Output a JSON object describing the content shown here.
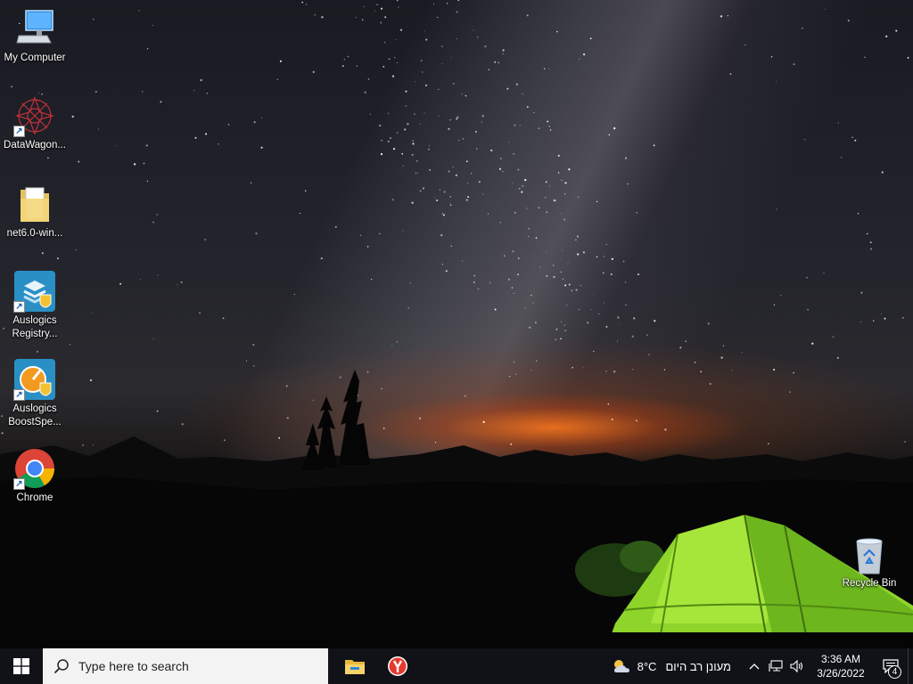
{
  "desktop": {
    "icons": [
      {
        "label": "My Computer",
        "icon": "computer-icon",
        "shortcut": false
      },
      {
        "label": "DataWagon...",
        "icon": "datawagon-icon",
        "shortcut": true
      },
      {
        "label": "net6.0-win...",
        "icon": "folder-icon",
        "shortcut": false
      },
      {
        "label": "Auslogics Registry...",
        "icon": "auslogics-registry-icon",
        "shortcut": true
      },
      {
        "label": "Auslogics BoostSpe...",
        "icon": "auslogics-boostspeed-icon",
        "shortcut": true
      },
      {
        "label": "Chrome",
        "icon": "chrome-icon",
        "shortcut": true
      },
      {
        "label": "Recycle Bin",
        "icon": "recycle-bin-icon",
        "shortcut": false
      }
    ]
  },
  "taskbar": {
    "search_placeholder": "Type here to search",
    "pinned_apps": [
      {
        "name": "File Explorer",
        "icon": "file-explorer-icon"
      },
      {
        "name": "Yandex Browser",
        "icon": "yandex-browser-icon"
      }
    ],
    "weather": {
      "temperature": "8°C",
      "condition": "מעונן רב היום",
      "icon": "partly-cloudy-icon"
    },
    "clock": {
      "time": "3:36 AM",
      "date": "3/26/2022"
    },
    "notifications": {
      "count": "4"
    }
  },
  "colors": {
    "taskbar_bg": "#101218",
    "search_bg": "#f3f3f3",
    "windows_logo": "#ffffff",
    "tent_green": "#8fd42a"
  }
}
